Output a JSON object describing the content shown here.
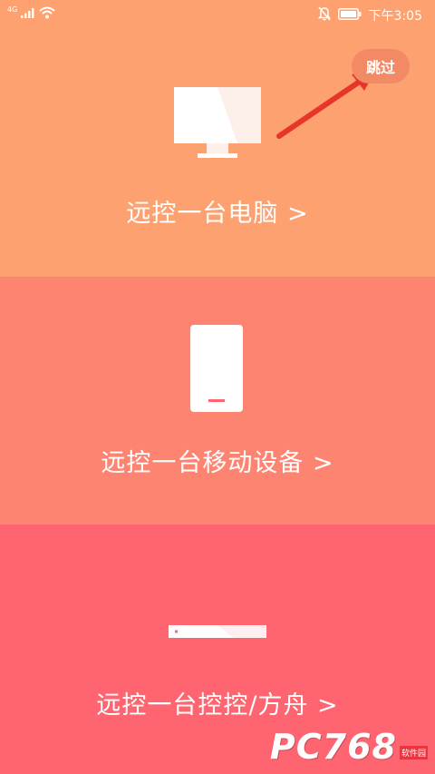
{
  "status_bar": {
    "network_label": "4G",
    "time": "下午3:05",
    "icons": [
      "signal-icon",
      "wifi-icon",
      "mute-bell-icon",
      "battery-icon"
    ]
  },
  "skip_button": {
    "label": "跳过"
  },
  "options": [
    {
      "label": "远控一台电脑 >",
      "icon": "monitor-icon",
      "color": "#fea170"
    },
    {
      "label": "远控一台移动设备 >",
      "icon": "phone-icon",
      "color": "#fe8472"
    },
    {
      "label": "远控一台控控/方舟 >",
      "icon": "control-box-icon",
      "color": "#fe6570"
    }
  ],
  "watermark": {
    "logo": "PC768",
    "sub": "软件园"
  },
  "colors": {
    "arrow": "#e8352a"
  }
}
